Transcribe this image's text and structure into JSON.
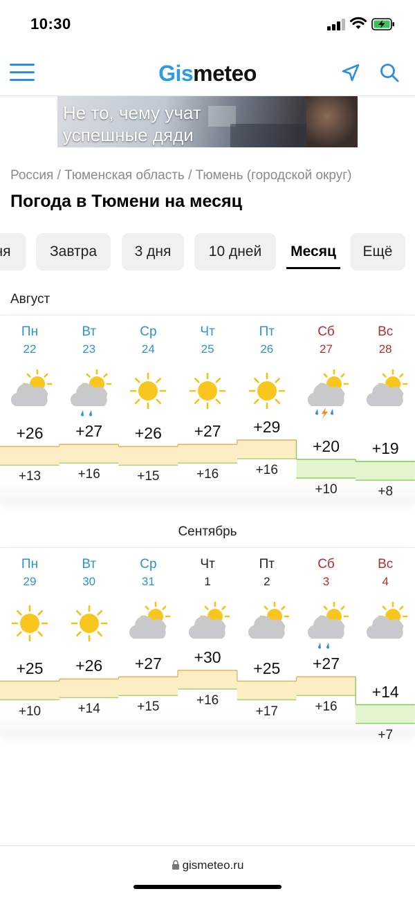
{
  "status_bar": {
    "time": "10:30"
  },
  "header": {
    "logo_gis": "Gis",
    "logo_meteo": "meteo"
  },
  "ad": {
    "line1": "Не то, чему учат",
    "line2": "успешные дяди"
  },
  "breadcrumb": {
    "country": "Россия",
    "region": "Тюменская область",
    "city": "Тюмень (городской округ)",
    "separator": " / "
  },
  "page_title": "Погода в Тюмени на месяц",
  "tabs": [
    {
      "label": "ня"
    },
    {
      "label": "Завтра"
    },
    {
      "label": "3 дня"
    },
    {
      "label": "10 дней"
    },
    {
      "label": "Месяц",
      "active": true
    },
    {
      "label": "Ещё"
    }
  ],
  "months": [
    {
      "label": "Август",
      "days": [
        {
          "name": "Пн",
          "date": "22",
          "color": "blue",
          "icon": "partly-cloudy-icon",
          "max": "+26",
          "min": "+13"
        },
        {
          "name": "Вт",
          "date": "23",
          "color": "blue",
          "icon": "cloudy-rain-icon",
          "max": "+27",
          "min": "+16"
        },
        {
          "name": "Ср",
          "date": "24",
          "color": "blue",
          "icon": "sun-icon",
          "max": "+26",
          "min": "+15"
        },
        {
          "name": "Чт",
          "date": "25",
          "color": "blue",
          "icon": "sun-icon",
          "max": "+27",
          "min": "+16"
        },
        {
          "name": "Пт",
          "date": "26",
          "color": "blue",
          "icon": "sun-icon",
          "max": "+29",
          "min": "+16"
        },
        {
          "name": "Сб",
          "date": "27",
          "color": "red",
          "icon": "thunderstorm-icon",
          "max": "+20",
          "min": "+10"
        },
        {
          "name": "Вс",
          "date": "28",
          "color": "red",
          "icon": "partly-cloudy-icon",
          "max": "+19",
          "min": "+8"
        }
      ]
    },
    {
      "label": "Сентябрь",
      "days": [
        {
          "name": "Пн",
          "date": "29",
          "color": "blue",
          "icon": "sun-icon",
          "max": "+25",
          "min": "+10"
        },
        {
          "name": "Вт",
          "date": "30",
          "color": "blue",
          "icon": "sun-icon",
          "max": "+26",
          "min": "+14"
        },
        {
          "name": "Ср",
          "date": "31",
          "color": "blue",
          "icon": "partly-cloudy-icon",
          "max": "+27",
          "min": "+15"
        },
        {
          "name": "Чт",
          "date": "1",
          "color": "black",
          "icon": "partly-cloudy-icon",
          "max": "+30",
          "min": "+16"
        },
        {
          "name": "Пт",
          "date": "2",
          "color": "black",
          "icon": "partly-cloudy-icon",
          "max": "+25",
          "min": "+17"
        },
        {
          "name": "Сб",
          "date": "3",
          "color": "red",
          "icon": "cloudy-rain-icon",
          "max": "+27",
          "min": "+16"
        },
        {
          "name": "Вс",
          "date": "4",
          "color": "red",
          "icon": "partly-cloudy-icon",
          "max": "+14",
          "min": "+7"
        }
      ]
    }
  ],
  "footer": {
    "url": "gismeteo.ru"
  },
  "colors": {
    "accent": "#2a9bea",
    "weekday": "#2f8fd8",
    "weekend": "#b03030",
    "warm_fill": "#fbedc4",
    "warm_line": "#e0b26a",
    "cool_fill": "#e3f5cf",
    "cool_line": "#8cc95a"
  }
}
